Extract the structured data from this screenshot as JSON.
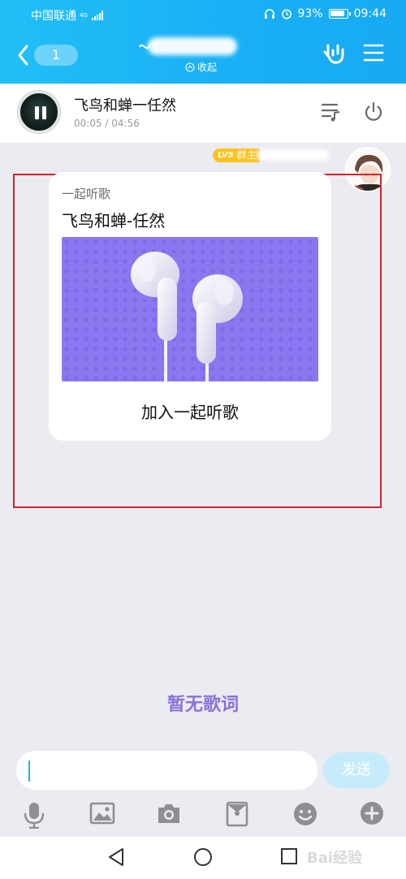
{
  "status_bar": {
    "carrier": "中国联通",
    "network": "4G",
    "battery": "93%",
    "time": "09:44"
  },
  "header": {
    "back_badge": "1",
    "collapse_label": "收起"
  },
  "player": {
    "song_title": "飞鸟和蝉一任然",
    "time": "00:05 / 04:56"
  },
  "message": {
    "level": "LV5",
    "role": "群主",
    "card": {
      "subtitle": "一起听歌",
      "song": "飞鸟和蝉-任然",
      "action": "加入一起听歌"
    }
  },
  "lyrics_placeholder": "暂无歌词",
  "input": {
    "value": "",
    "send_label": "发送"
  },
  "watermark": "Bai经验",
  "colors": {
    "header": "#19b0f5",
    "card_image": "#8a78f0",
    "lyrics": "#8a72d8",
    "level_badge": "#ffc21c",
    "frame": "#d3232c"
  },
  "icons": [
    "back-icon",
    "rock-hand-icon",
    "menu-icon",
    "playlist-icon",
    "power-icon",
    "mic-icon",
    "image-icon",
    "camera-icon",
    "red-packet-icon",
    "emoji-icon",
    "plus-icon",
    "nav-back-icon",
    "nav-home-icon",
    "nav-recents-icon"
  ]
}
